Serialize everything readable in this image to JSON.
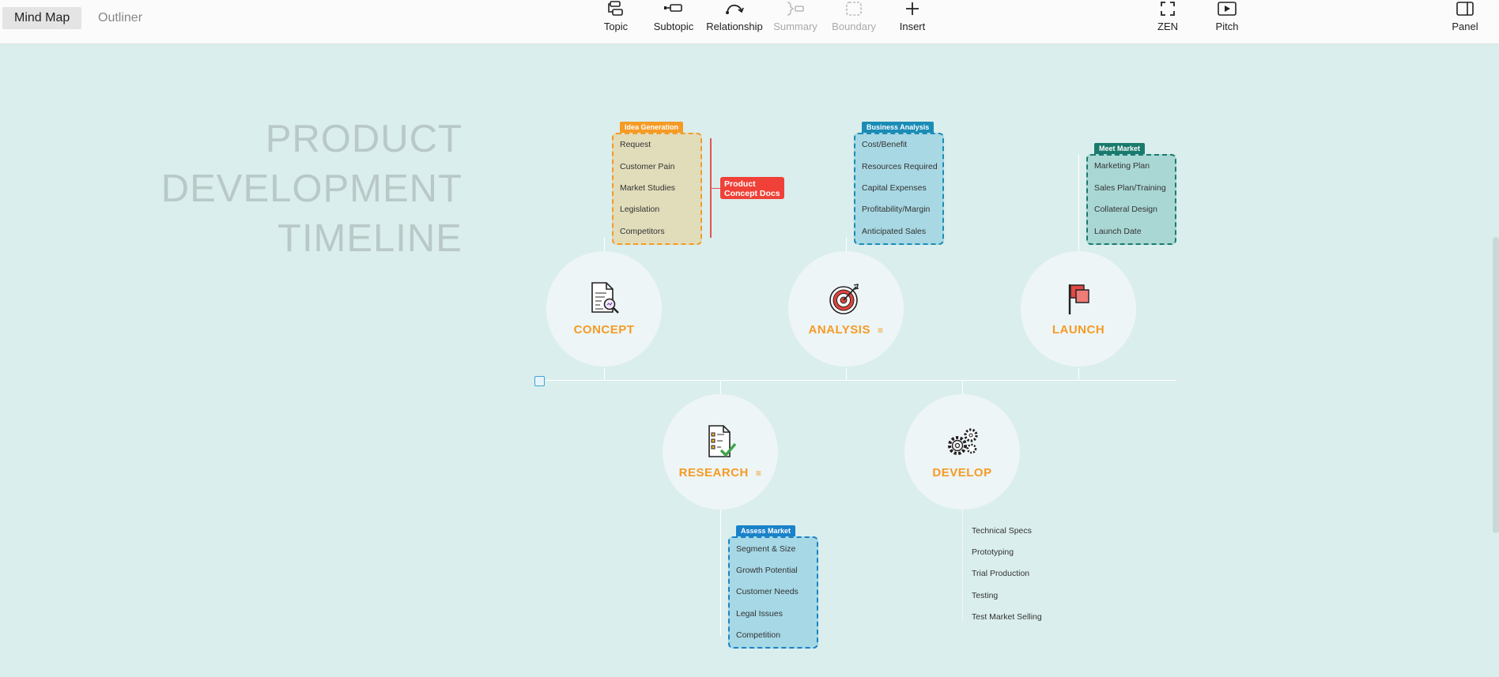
{
  "toolbar": {
    "view_tabs": [
      {
        "label": "Mind Map"
      },
      {
        "label": "Outliner"
      }
    ],
    "tools": [
      {
        "label": "Topic",
        "icon": "topic-icon"
      },
      {
        "label": "Subtopic",
        "icon": "subtopic-icon"
      },
      {
        "label": "Relationship",
        "icon": "relationship-icon"
      },
      {
        "label": "Summary",
        "icon": "summary-icon",
        "disabled": true
      },
      {
        "label": "Boundary",
        "icon": "boundary-icon",
        "disabled": true
      },
      {
        "label": "Insert",
        "icon": "plus-icon"
      }
    ],
    "right_tools": [
      {
        "label": "ZEN",
        "icon": "zen-fullscreen-icon"
      },
      {
        "label": "Pitch",
        "icon": "pitch-play-icon"
      },
      {
        "label": "Panel",
        "icon": "panel-icon"
      }
    ]
  },
  "map": {
    "title_lines": [
      "PRODUCT",
      "DEVELOPMENT",
      "TIMELINE"
    ],
    "nodes": [
      {
        "name": "CONCEPT",
        "icon": "document-search-icon"
      },
      {
        "name": "ANALYSIS",
        "icon": "target-icon",
        "has_note": true
      },
      {
        "name": "LAUNCH",
        "icon": "flag-icon"
      },
      {
        "name": "RESEARCH",
        "icon": "checklist-icon",
        "has_note": true
      },
      {
        "name": "DEVELOP",
        "icon": "gears-icon"
      }
    ],
    "boundaries": {
      "idea_generation": {
        "tag": "Idea Generation",
        "items": [
          "Request",
          "Customer Pain",
          "Market Studies",
          "Legislation",
          "Competitors"
        ],
        "color": "#f59b25",
        "fill": "#e1dcba"
      },
      "business_analysis": {
        "tag": "Business Analysis",
        "items": [
          "Cost/Benefit",
          "Resources Required",
          "Capital Expenses",
          "Profitability/Margin",
          "Anticipated Sales"
        ],
        "color": "#1a8cb6",
        "fill": "#a8d8e3"
      },
      "meet_market": {
        "tag": "Meet Market",
        "items": [
          "Marketing Plan",
          "Sales Plan/Training",
          "Collateral Design",
          "Launch Date"
        ],
        "color": "#1b7a6e",
        "fill": "#a9d7d4"
      },
      "assess_market": {
        "tag": "Assess Market",
        "items": [
          "Segment & Size",
          "Growth Potential",
          "Customer Needs",
          "Legal Issues",
          "Competition"
        ],
        "color": "#1a82c9",
        "fill": "#a6d8e6"
      }
    },
    "develop_items": [
      "Technical Specs",
      "Prototyping",
      "Trial Production",
      "Testing",
      "Test Market Selling"
    ],
    "callout": "Product Concept Docs"
  },
  "colors": {
    "canvas": "#daeeed",
    "accent_orange": "#f59b25",
    "callout_red": "#ef4138"
  }
}
